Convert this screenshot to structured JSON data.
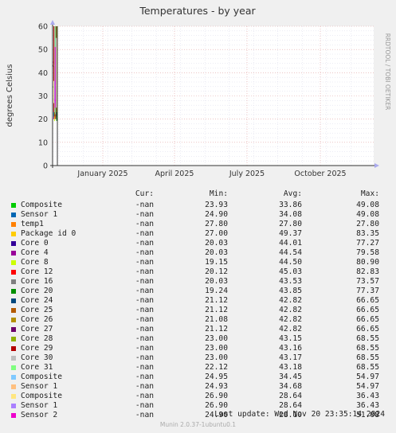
{
  "chart_data": {
    "type": "line",
    "title": "Temperatures - by year",
    "ylabel": "degrees Celsius",
    "side_label": "RRDTOOL / TOBI OETIKER",
    "ylim": [
      0,
      60
    ],
    "yticks": [
      0,
      10,
      20,
      30,
      40,
      50,
      60
    ],
    "xticks": [
      "January 2025",
      "April 2025",
      "July 2025",
      "October 2025"
    ],
    "grid": true,
    "legend_headers": {
      "cur": "Cur:",
      "min": "Min:",
      "avg": "Avg:",
      "max": "Max:"
    },
    "series": [
      {
        "name": "Composite",
        "color": "#00cc00",
        "cur": "-nan",
        "min": "23.93",
        "avg": "33.86",
        "max": "49.08"
      },
      {
        "name": "Sensor 1",
        "color": "#0066b3",
        "cur": "-nan",
        "min": "24.90",
        "avg": "34.08",
        "max": "49.08"
      },
      {
        "name": "temp1",
        "color": "#ff8000",
        "cur": "-nan",
        "min": "27.80",
        "avg": "27.80",
        "max": "27.80"
      },
      {
        "name": "Package id 0",
        "color": "#ffcc00",
        "cur": "-nan",
        "min": "27.00",
        "avg": "49.37",
        "max": "83.35"
      },
      {
        "name": "Core 0",
        "color": "#330099",
        "cur": "-nan",
        "min": "20.03",
        "avg": "44.01",
        "max": "77.27"
      },
      {
        "name": "Core 4",
        "color": "#990099",
        "cur": "-nan",
        "min": "20.03",
        "avg": "44.54",
        "max": "79.58"
      },
      {
        "name": "Core 8",
        "color": "#ccff00",
        "cur": "-nan",
        "min": "19.15",
        "avg": "44.50",
        "max": "80.90"
      },
      {
        "name": "Core 12",
        "color": "#ff0000",
        "cur": "-nan",
        "min": "20.12",
        "avg": "45.03",
        "max": "82.83"
      },
      {
        "name": "Core 16",
        "color": "#808080",
        "cur": "-nan",
        "min": "20.03",
        "avg": "43.53",
        "max": "73.57"
      },
      {
        "name": "Core 20",
        "color": "#008f00",
        "cur": "-nan",
        "min": "19.24",
        "avg": "43.85",
        "max": "77.37"
      },
      {
        "name": "Core 24",
        "color": "#00487d",
        "cur": "-nan",
        "min": "21.12",
        "avg": "42.82",
        "max": "66.65"
      },
      {
        "name": "Core 25",
        "color": "#b35a00",
        "cur": "-nan",
        "min": "21.12",
        "avg": "42.82",
        "max": "66.65"
      },
      {
        "name": "Core 26",
        "color": "#b38f00",
        "cur": "-nan",
        "min": "21.08",
        "avg": "42.82",
        "max": "66.65"
      },
      {
        "name": "Core 27",
        "color": "#6b006b",
        "cur": "-nan",
        "min": "21.12",
        "avg": "42.82",
        "max": "66.65"
      },
      {
        "name": "Core 28",
        "color": "#8fb300",
        "cur": "-nan",
        "min": "23.00",
        "avg": "43.15",
        "max": "68.55"
      },
      {
        "name": "Core 29",
        "color": "#b30000",
        "cur": "-nan",
        "min": "23.00",
        "avg": "43.16",
        "max": "68.55"
      },
      {
        "name": "Core 30",
        "color": "#bebebe",
        "cur": "-nan",
        "min": "23.00",
        "avg": "43.17",
        "max": "68.55"
      },
      {
        "name": "Core 31",
        "color": "#80ff80",
        "cur": "-nan",
        "min": "22.12",
        "avg": "43.18",
        "max": "68.55"
      },
      {
        "name": "Composite",
        "color": "#80c9ff",
        "cur": "-nan",
        "min": "24.95",
        "avg": "34.45",
        "max": "54.97"
      },
      {
        "name": "Sensor 1",
        "color": "#ffc080",
        "cur": "-nan",
        "min": "24.93",
        "avg": "34.68",
        "max": "54.97"
      },
      {
        "name": "Composite",
        "color": "#ffe680",
        "cur": "-nan",
        "min": "26.90",
        "avg": "28.64",
        "max": "36.43"
      },
      {
        "name": "Sensor 1",
        "color": "#aa80ff",
        "cur": "-nan",
        "min": "26.90",
        "avg": "28.64",
        "max": "36.43"
      },
      {
        "name": "Sensor 2",
        "color": "#ee00cc",
        "cur": "-nan",
        "min": "24.90",
        "avg": "28.10",
        "max": "51.08"
      }
    ]
  },
  "footer": {
    "last_update": "Last update: Wed Nov 20 23:35:14 2024",
    "munin_version": "Munin 2.0.37-1ubuntu0.1"
  }
}
